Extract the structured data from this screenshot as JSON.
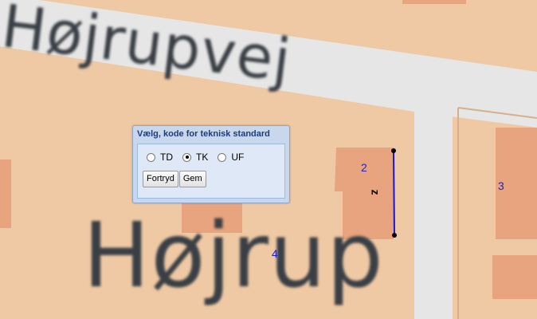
{
  "map": {
    "street_label": "Højrupvej",
    "area_label": "Højrup",
    "house_numbers": [
      "2",
      "3",
      "4"
    ],
    "segment_label": "z",
    "colors": {
      "background": "#efc9a4",
      "road": "#e6e6e6",
      "building": "#e8a47e",
      "selected_line": "#1515d6",
      "house_number": "#1f22c8"
    }
  },
  "dialog": {
    "title": "Vælg, kode for teknisk standard",
    "options": [
      {
        "label": "TD",
        "checked": false
      },
      {
        "label": "TK",
        "checked": true
      },
      {
        "label": "UF",
        "checked": false
      }
    ],
    "buttons": {
      "cancel": "Fortryd",
      "save": "Gem"
    }
  }
}
